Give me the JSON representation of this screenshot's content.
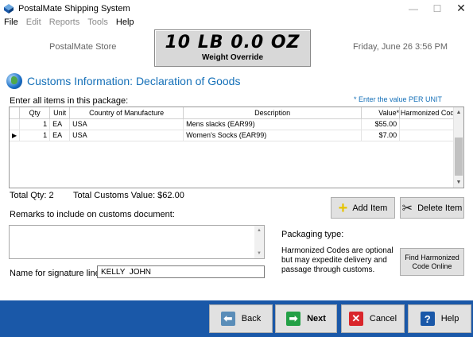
{
  "window": {
    "title": "PostalMate Shipping System",
    "controls": {
      "minimize": "—",
      "maximize": "☐",
      "close": "✕"
    }
  },
  "menu": [
    {
      "label": "File",
      "disabled": false
    },
    {
      "label": "Edit",
      "disabled": true
    },
    {
      "label": "Reports",
      "disabled": true
    },
    {
      "label": "Tools",
      "disabled": true
    },
    {
      "label": "Help",
      "disabled": false
    }
  ],
  "header": {
    "store": "PostalMate Store",
    "weight": "10 LB 0.0 OZ",
    "weight_label": "Weight Override",
    "datetime": "Friday, June 26  3:56 PM"
  },
  "section": {
    "title": "Customs Information: Declaration of Goods"
  },
  "items": {
    "prompt": "Enter all items in this package:",
    "note": "* Enter the value PER UNIT",
    "columns": {
      "qty": "Qty",
      "unit": "Unit",
      "country": "Country of Manufacture",
      "description": "Description",
      "value": "Value*",
      "hs": "Harmonized Code"
    },
    "rows": [
      {
        "indicator": "",
        "qty": "1",
        "unit": "EA",
        "country": "USA",
        "description": "Mens slacks (EAR99)",
        "value": "$55.00",
        "hs": ""
      },
      {
        "indicator": "▶",
        "qty": "1",
        "unit": "EA",
        "country": "USA",
        "description": "Women's Socks (EAR99)",
        "value": "$7.00",
        "hs": ""
      }
    ]
  },
  "totals": {
    "qty": "Total Qty:  2",
    "value": "Total Customs Value:  $62.00"
  },
  "buttons": {
    "add": "Add Item",
    "delete": "Delete Item",
    "find_hs": "Find Harmonized Code Online"
  },
  "remarks": {
    "label": "Remarks to include on customs document:",
    "value": ""
  },
  "packaging": {
    "label": "Packaging type:"
  },
  "hs_note": "Harmonized Codes are optional but may expedite delivery and passage through customs.",
  "signature": {
    "label": "Name for signature line:",
    "value": "KELLY  JOHN"
  },
  "footer": {
    "back": "Back",
    "next": "Next",
    "cancel": "Cancel",
    "help": "Help"
  },
  "colors": {
    "accent": "#1570b8",
    "footer": "#1a58a8"
  }
}
